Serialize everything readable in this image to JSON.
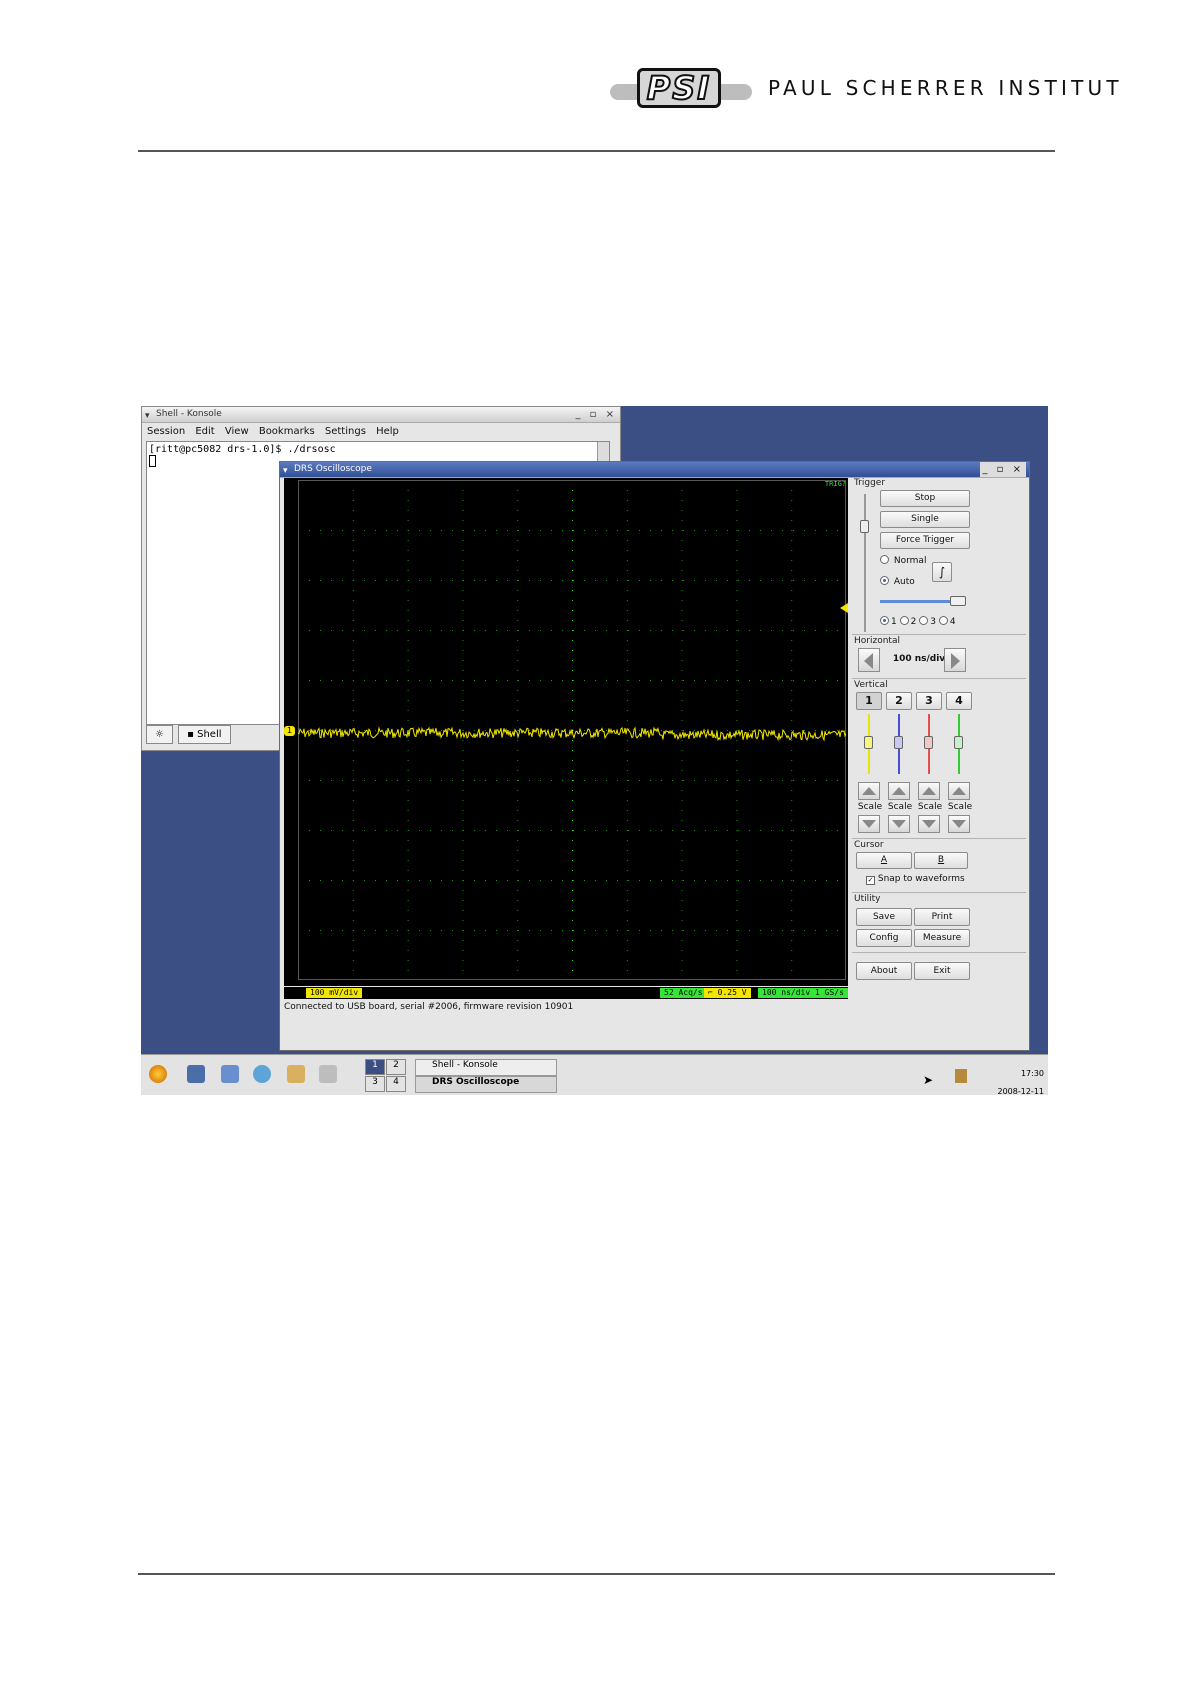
{
  "header": {
    "logo_text": "PSI",
    "institute": "PAUL SCHERRER INSTITUT"
  },
  "konsole": {
    "title": "Shell - Konsole",
    "menu": [
      "Session",
      "Edit",
      "View",
      "Bookmarks",
      "Settings",
      "Help"
    ],
    "prompt": "[ritt@pc5082 drs-1.0]$ ./drsosc",
    "tab_label": "Shell"
  },
  "drs": {
    "title": "DRS Oscilloscope",
    "trig_status": "TRIG?",
    "channel_marker": "1",
    "badges": {
      "volts_div": "100 mV/div",
      "acq_rate": "52 Acq/s",
      "trigger_level": "0.25 V",
      "timebase": "100 ns/div  1 GS/s"
    },
    "status": "Connected to USB board, serial #2006, firmware revision 10901",
    "trigger": {
      "label": "Trigger",
      "stop": "Stop",
      "single": "Single",
      "force": "Force Trigger",
      "normal": "Normal",
      "auto": "Auto",
      "sources": [
        "1",
        "2",
        "3",
        "4"
      ]
    },
    "horizontal": {
      "label": "Horizontal",
      "value": "100 ns/div"
    },
    "vertical": {
      "label": "Vertical",
      "channels": [
        "1",
        "2",
        "3",
        "4"
      ],
      "scale_label": "Scale",
      "channel_colors": [
        "#e6e600",
        "#4d4dd9",
        "#e64d4d",
        "#33cc33"
      ]
    },
    "cursor": {
      "label": "Cursor",
      "a": "A",
      "b": "B",
      "snap": "Snap to waveforms"
    },
    "utility": {
      "label": "Utility",
      "save": "Save",
      "print": "Print",
      "config": "Config",
      "measure": "Measure",
      "about": "About",
      "exit": "Exit"
    }
  },
  "taskbar": {
    "desktops": [
      "1",
      "2",
      "3",
      "4"
    ],
    "tasks": [
      "Shell - Konsole",
      "DRS Oscilloscope"
    ],
    "time": "17:30",
    "date": "2008-12-11"
  }
}
